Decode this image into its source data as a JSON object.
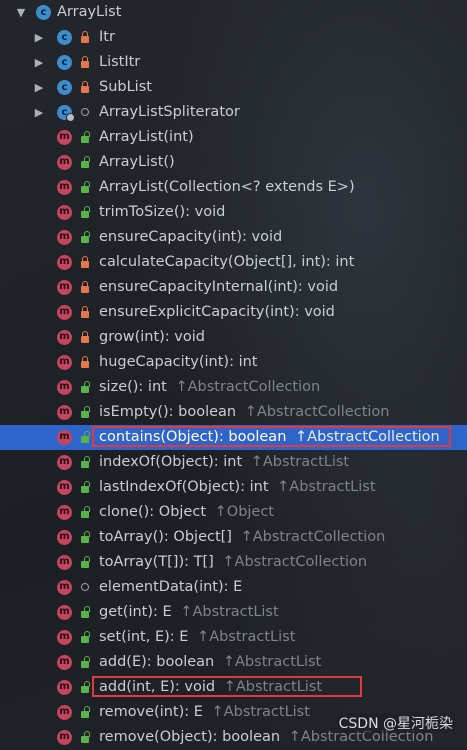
{
  "tree": {
    "root": {
      "label": "ArrayList",
      "icon": "class-icon"
    },
    "inner_classes": [
      {
        "label": "Itr",
        "visibility": "private"
      },
      {
        "label": "ListItr",
        "visibility": "private"
      },
      {
        "label": "SubList",
        "visibility": "private"
      },
      {
        "label": "ArrayListSpliterator",
        "visibility": "package"
      }
    ],
    "members": [
      {
        "signature": "ArrayList(int)",
        "inherited": "",
        "visibility": "public"
      },
      {
        "signature": "ArrayList()",
        "inherited": "",
        "visibility": "public"
      },
      {
        "signature": "ArrayList(Collection<? extends E>)",
        "inherited": "",
        "visibility": "public"
      },
      {
        "signature": "trimToSize(): void",
        "inherited": "",
        "visibility": "public"
      },
      {
        "signature": "ensureCapacity(int): void",
        "inherited": "",
        "visibility": "public"
      },
      {
        "signature": "calculateCapacity(Object[], int): int",
        "inherited": "",
        "visibility": "private"
      },
      {
        "signature": "ensureCapacityInternal(int): void",
        "inherited": "",
        "visibility": "private"
      },
      {
        "signature": "ensureExplicitCapacity(int): void",
        "inherited": "",
        "visibility": "private"
      },
      {
        "signature": "grow(int): void",
        "inherited": "",
        "visibility": "private"
      },
      {
        "signature": "hugeCapacity(int): int",
        "inherited": "",
        "visibility": "private"
      },
      {
        "signature": "size(): int",
        "inherited": "AbstractCollection",
        "visibility": "public"
      },
      {
        "signature": "isEmpty(): boolean",
        "inherited": "AbstractCollection",
        "visibility": "public"
      },
      {
        "signature": "contains(Object): boolean",
        "inherited": "AbstractCollection",
        "visibility": "public"
      },
      {
        "signature": "indexOf(Object): int",
        "inherited": "AbstractList",
        "visibility": "public"
      },
      {
        "signature": "lastIndexOf(Object): int",
        "inherited": "AbstractList",
        "visibility": "public"
      },
      {
        "signature": "clone(): Object",
        "inherited": "Object",
        "visibility": "public"
      },
      {
        "signature": "toArray(): Object[]",
        "inherited": "AbstractCollection",
        "visibility": "public"
      },
      {
        "signature": "toArray(T[]): T[]",
        "inherited": "AbstractCollection",
        "visibility": "public"
      },
      {
        "signature": "elementData(int): E",
        "inherited": "",
        "visibility": "package"
      },
      {
        "signature": "get(int): E",
        "inherited": "AbstractList",
        "visibility": "public"
      },
      {
        "signature": "set(int, E): E",
        "inherited": "AbstractList",
        "visibility": "public"
      },
      {
        "signature": "add(E): boolean",
        "inherited": "AbstractList",
        "visibility": "public"
      },
      {
        "signature": "add(int, E): void",
        "inherited": "AbstractList",
        "visibility": "public"
      },
      {
        "signature": "remove(int): E",
        "inherited": "AbstractList",
        "visibility": "public"
      },
      {
        "signature": "remove(Object): boolean",
        "inherited": "AbstractCollection",
        "visibility": "public"
      }
    ],
    "icon_letters": {
      "class": "c",
      "method": "m"
    },
    "inherited_arrow": "↑"
  },
  "selection": {
    "selected_member": "contains(Object): boolean"
  },
  "highlights": [
    "contains(Object): boolean",
    "add(int, E): void"
  ],
  "watermark": "CSDN @星河栀染",
  "colors": {
    "background": "#1f2226",
    "selected_row": "#2f65ca",
    "highlight_box": "#e0393e",
    "class_icon": "#3d8ccc",
    "method_icon": "#c4455e",
    "public": "#58b44a",
    "private": "#e4784d",
    "inherited_text": "#7d848b"
  }
}
